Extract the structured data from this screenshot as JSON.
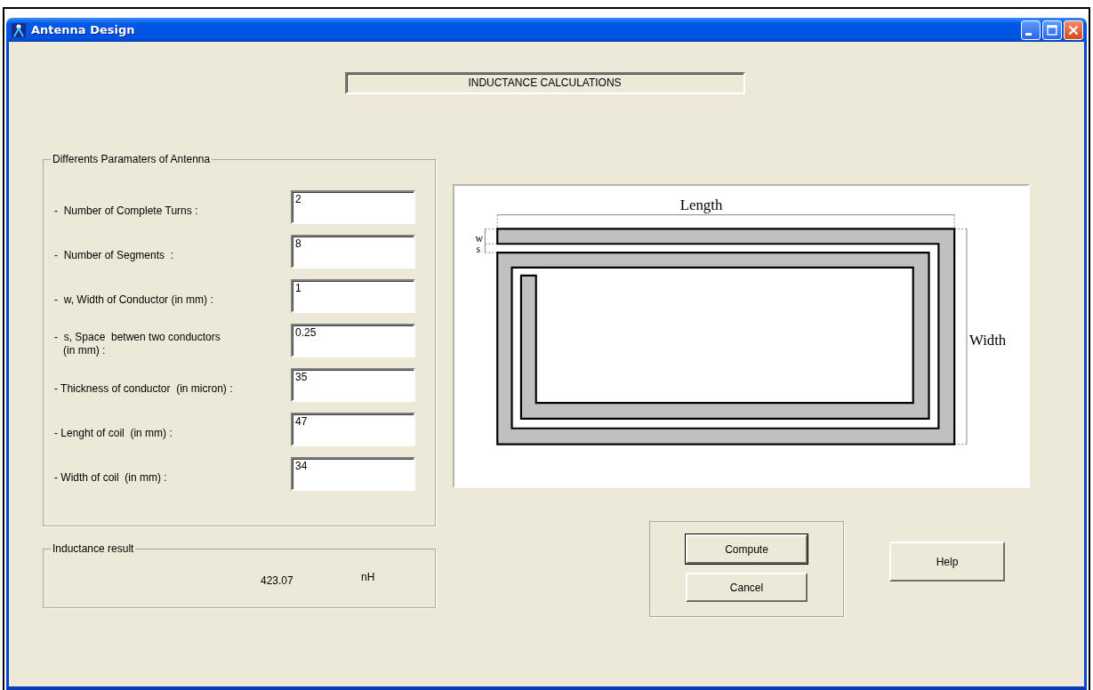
{
  "window": {
    "title": "Antenna Design"
  },
  "heading": "INDUCTANCE CALCULATIONS",
  "parameters": {
    "title": "Differents Paramaters of Antenna",
    "rows": [
      {
        "label": "-  Number of Complete Turns :",
        "value": "2"
      },
      {
        "label": "-  Number of Segments  :",
        "value": "8"
      },
      {
        "label": "-  w, Width of Conductor (in mm) :",
        "value": "1"
      },
      {
        "label": "-  s, Space  betwen two conductors\n   (in mm) :",
        "value": "0.25"
      },
      {
        "label": "- Thickness of conductor  (in micron) :",
        "value": "35"
      },
      {
        "label": "- Lenght of coil  (in mm) :",
        "value": "47"
      },
      {
        "label": "- Width of coil  (in mm) :",
        "value": "34"
      }
    ]
  },
  "diagram": {
    "length_label": "Length",
    "width_label": "Width",
    "w_label": "w",
    "s_label": "s"
  },
  "result": {
    "title": "Inductance result",
    "value": "423.07",
    "unit": "nH"
  },
  "buttons": {
    "compute": "Compute",
    "cancel": "Cancel",
    "help": "Help"
  }
}
